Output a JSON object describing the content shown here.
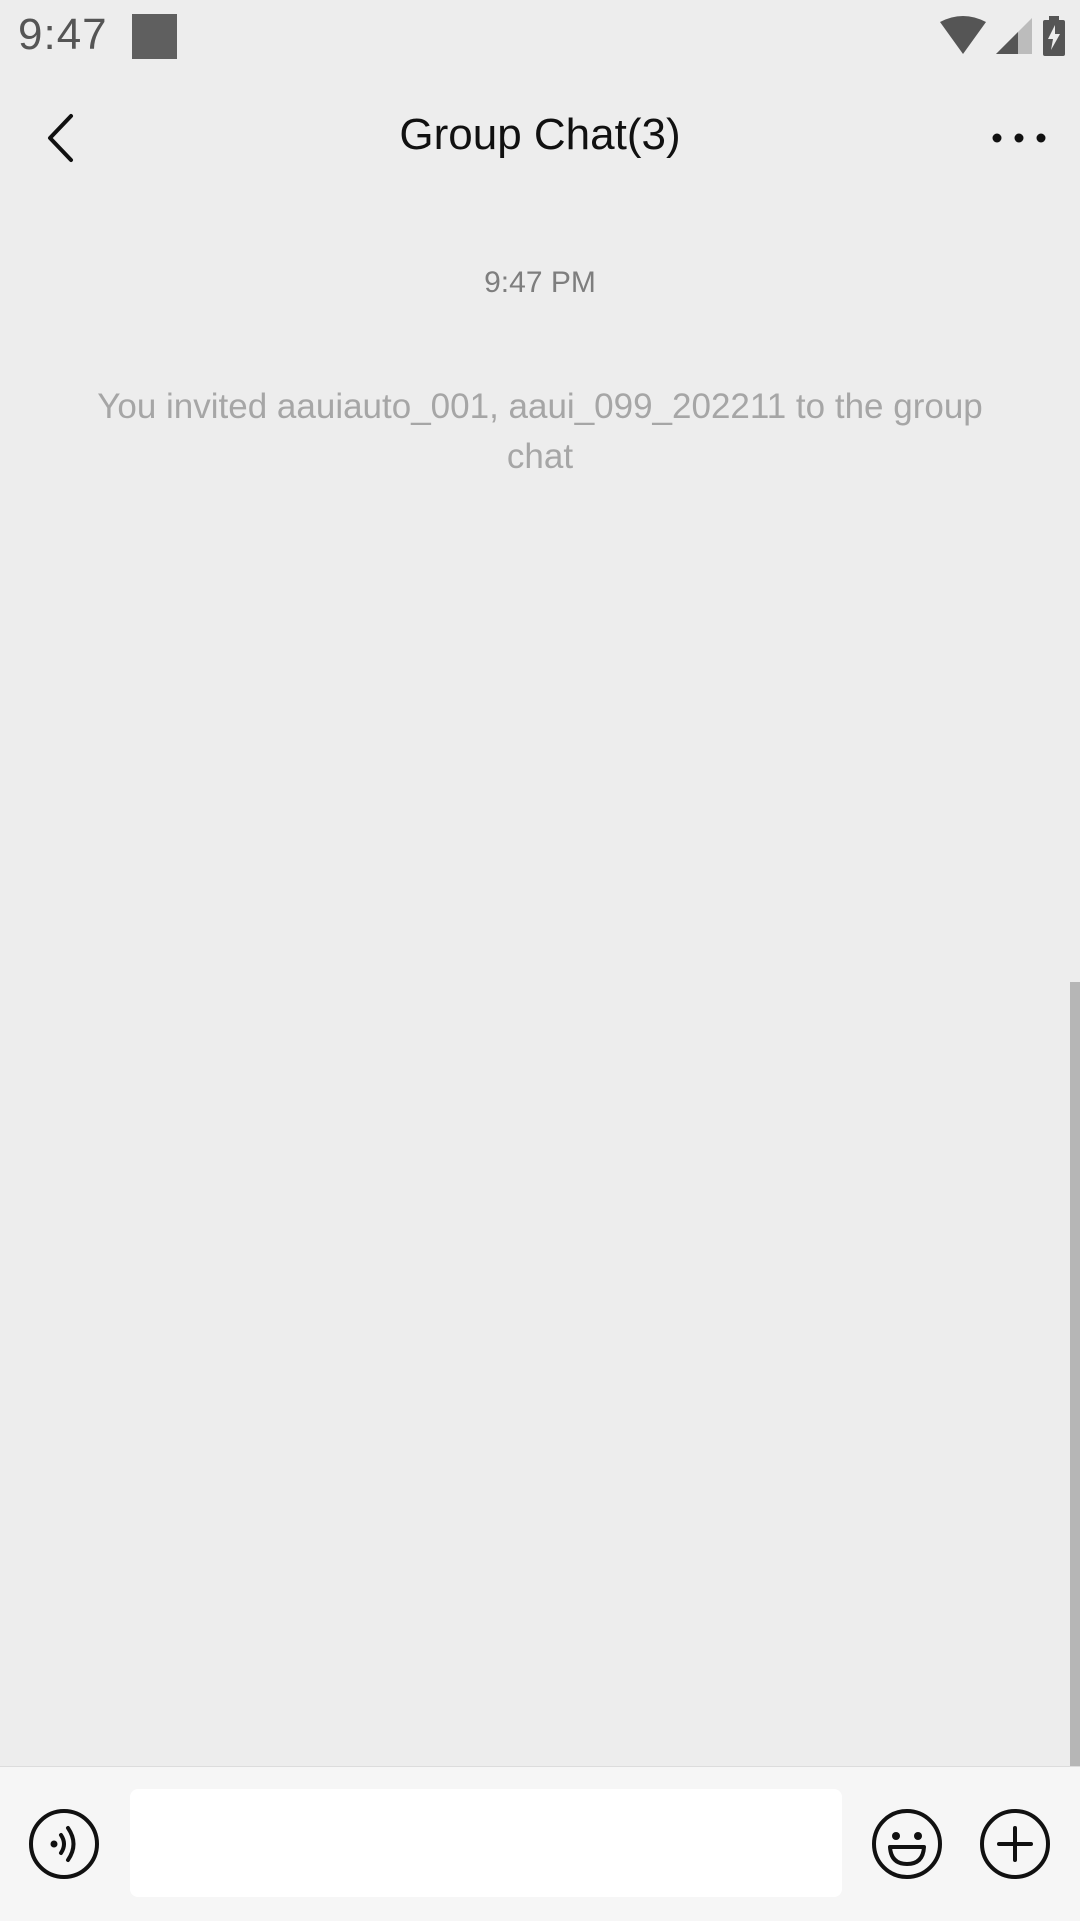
{
  "status_bar": {
    "time": "9:47",
    "icons": [
      "notification-square-icon",
      "wifi-icon",
      "signal-icon",
      "battery-charging-icon"
    ]
  },
  "header": {
    "title": "Group Chat(3)",
    "back_icon": "chevron-left-icon",
    "more_icon": "more-horizontal-icon"
  },
  "chat": {
    "timestamp": "9:47 PM",
    "system_message": "You invited aauiauto_001, aaui_099_202211  to the group chat"
  },
  "input_bar": {
    "voice_icon": "voice-icon",
    "input_value": "",
    "emoji_icon": "emoji-icon",
    "plus_icon": "plus-icon"
  },
  "colors": {
    "background": "#ededed",
    "input_bar_background": "#f6f6f6",
    "title_text": "#111111",
    "system_text": "#a6a6a6"
  }
}
